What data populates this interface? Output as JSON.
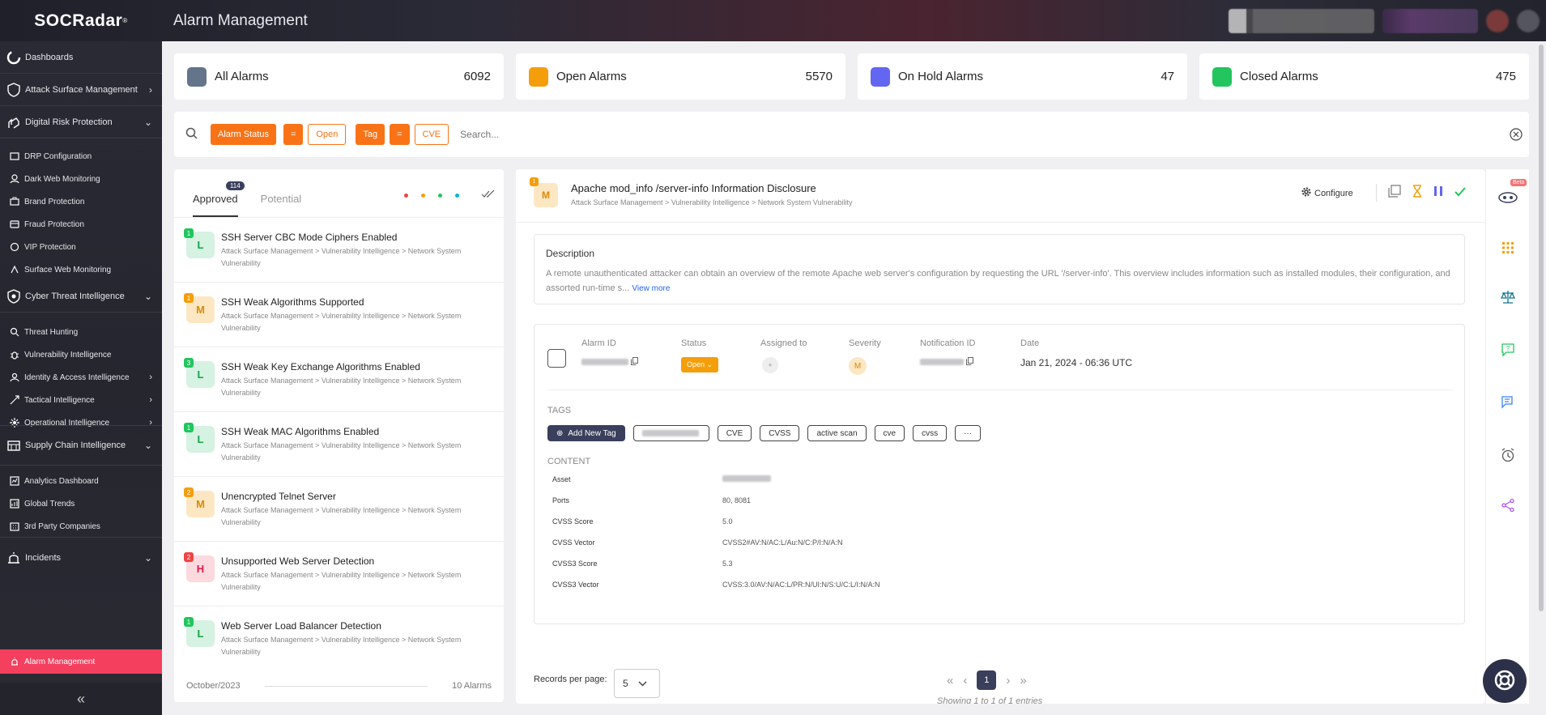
{
  "app": {
    "logo": "SOCRadar",
    "logo_mark": "®",
    "title": "Alarm Management"
  },
  "sidebar": {
    "items": [
      {
        "label": "Dashboards",
        "type": "main",
        "icon": "dashboard-icon"
      },
      {
        "label": "Attack Surface Management",
        "type": "main",
        "icon": "shield-icon",
        "chevron": "›"
      },
      {
        "label": "Digital Risk Protection",
        "type": "main",
        "icon": "hand-shield-icon",
        "chevron": "⌄"
      },
      {
        "label": "DRP Configuration",
        "type": "sub",
        "icon": "config-icon"
      },
      {
        "label": "Dark Web Monitoring",
        "type": "sub",
        "icon": "spy-icon"
      },
      {
        "label": "Brand Protection",
        "type": "sub",
        "icon": "brand-icon"
      },
      {
        "label": "Fraud Protection",
        "type": "sub",
        "icon": "card-icon"
      },
      {
        "label": "VIP Protection",
        "type": "sub",
        "icon": "vip-icon"
      },
      {
        "label": "Surface Web Monitoring",
        "type": "sub",
        "icon": "monitor-icon"
      },
      {
        "label": "Cyber Threat Intelligence",
        "type": "main",
        "icon": "cyber-icon",
        "chevron": "⌄"
      },
      {
        "label": "Threat Hunting",
        "type": "sub",
        "icon": "search-icon"
      },
      {
        "label": "Vulnerability Intelligence",
        "type": "sub",
        "icon": "bug-icon"
      },
      {
        "label": "Identity & Access Intelligence",
        "type": "sub",
        "icon": "id-icon",
        "chevron": "›"
      },
      {
        "label": "Tactical Intelligence",
        "type": "sub",
        "icon": "tactical-icon",
        "chevron": "›"
      },
      {
        "label": "Operational Intelligence",
        "type": "sub",
        "icon": "ops-icon",
        "chevron": "›"
      },
      {
        "label": "Supply Chain Intelligence",
        "type": "main",
        "icon": "supply-icon",
        "chevron": "⌄"
      },
      {
        "label": "Analytics Dashboard",
        "type": "sub",
        "icon": "analytics-icon"
      },
      {
        "label": "Global Trends",
        "type": "sub",
        "icon": "trends-icon"
      },
      {
        "label": "3rd Party Companies",
        "type": "sub",
        "icon": "company-icon"
      },
      {
        "label": "Incidents",
        "type": "main",
        "icon": "incident-icon",
        "chevron": "⌄"
      },
      {
        "label": "Alarm Management",
        "type": "sub",
        "icon": "alarm-icon",
        "active": true
      }
    ],
    "collapse_label": "«"
  },
  "stats": [
    {
      "label": "All Alarms",
      "count": "6092",
      "color": "#64748b"
    },
    {
      "label": "Open Alarms",
      "count": "5570",
      "color": "#f59e0b"
    },
    {
      "label": "On Hold Alarms",
      "count": "47",
      "color": "#6366f1"
    },
    {
      "label": "Closed Alarms",
      "count": "475",
      "color": "#22c55e"
    }
  ],
  "filters": {
    "chips": [
      "Alarm Status",
      "=",
      "Open",
      "Tag",
      "=",
      "CVE"
    ],
    "search_placeholder": "Search..."
  },
  "list": {
    "tabs": [
      {
        "label": "Approved",
        "badge": "114"
      },
      {
        "label": "Potential"
      }
    ],
    "dot_colors": [
      "#ef4444",
      "#f59e0b",
      "#22c55e",
      "#06b6d4"
    ],
    "items": [
      {
        "count": "1",
        "level": "L",
        "title": "SSH Server CBC Mode Ciphers Enabled",
        "path": "Attack Surface Management > Vulnerability Intelligence > Network System Vulnerability"
      },
      {
        "count": "1",
        "level": "M",
        "title": "SSH Weak Algorithms Supported",
        "path": "Attack Surface Management > Vulnerability Intelligence > Network System Vulnerability"
      },
      {
        "count": "3",
        "level": "L",
        "title": "SSH Weak Key Exchange Algorithms Enabled",
        "path": "Attack Surface Management > Vulnerability Intelligence > Network System Vulnerability"
      },
      {
        "count": "1",
        "level": "L",
        "title": "SSH Weak MAC Algorithms Enabled",
        "path": "Attack Surface Management > Vulnerability Intelligence > Network System Vulnerability"
      },
      {
        "count": "2",
        "level": "M",
        "title": "Unencrypted Telnet Server",
        "path": "Attack Surface Management > Vulnerability Intelligence > Network System Vulnerability"
      },
      {
        "count": "2",
        "level": "H",
        "title": "Unsupported Web Server Detection",
        "path": "Attack Surface Management > Vulnerability Intelligence > Network System Vulnerability"
      },
      {
        "count": "1",
        "level": "L",
        "title": "Web Server Load Balancer Detection",
        "path": "Attack Surface Management > Vulnerability Intelligence > Network System Vulnerability"
      }
    ],
    "footer_month": "October/2023",
    "footer_count": "10 Alarms"
  },
  "detail": {
    "count": "1",
    "level": "M",
    "title": "Apache mod_info /server-info Information Disclosure",
    "path": "Attack Surface Management > Vulnerability Intelligence > Network System Vulnerability",
    "configure_label": "Configure",
    "description_heading": "Description",
    "description": "A remote unauthenticated attacker can obtain an overview of the remote Apache web server's configuration by requesting the URL '/server-info'. This overview includes information such as installed modules, their configuration, and assorted run-time s...",
    "view_more": "View more",
    "fields": {
      "alarm_id_label": "Alarm ID",
      "status_label": "Status",
      "status_value": "Open",
      "assigned_label": "Assigned to",
      "assigned_value": "+",
      "severity_label": "Severity",
      "severity_value": "M",
      "notification_label": "Notification ID",
      "date_label": "Date",
      "date_value": "Jan 21, 2024 - 06:36 UTC"
    },
    "tags_heading": "TAGS",
    "add_tag_label": "Add New Tag",
    "tags": [
      "CVE",
      "CVSS",
      "active scan",
      "cve",
      "cvss",
      "···"
    ],
    "content_heading": "CONTENT",
    "content_rows": [
      {
        "key": "Asset",
        "value": ""
      },
      {
        "key": "Ports",
        "value": "80, 8081"
      },
      {
        "key": "CVSS Score",
        "value": "5.0"
      },
      {
        "key": "CVSS Vector",
        "value": "CVSS2#AV:N/AC:L/Au:N/C:P/I:N/A:N"
      },
      {
        "key": "CVSS3 Score",
        "value": "5.3"
      },
      {
        "key": "CVSS3 Vector",
        "value": "CVSS:3.0/AV:N/AC:L/PR:N/UI:N/S:U/C:L/I:N/A:N"
      }
    ]
  },
  "pager": {
    "records_label": "Records per page:",
    "per_page": "5",
    "current_page": "1",
    "showing": "Showing 1 to 1 of 1 entries"
  },
  "rightbar": {
    "icons": [
      "robot-icon",
      "grid-icon",
      "scale-icon",
      "question-chat-icon",
      "chat-icon",
      "alarm-clock-icon",
      "share-icon"
    ],
    "beta_label": "Beta"
  }
}
